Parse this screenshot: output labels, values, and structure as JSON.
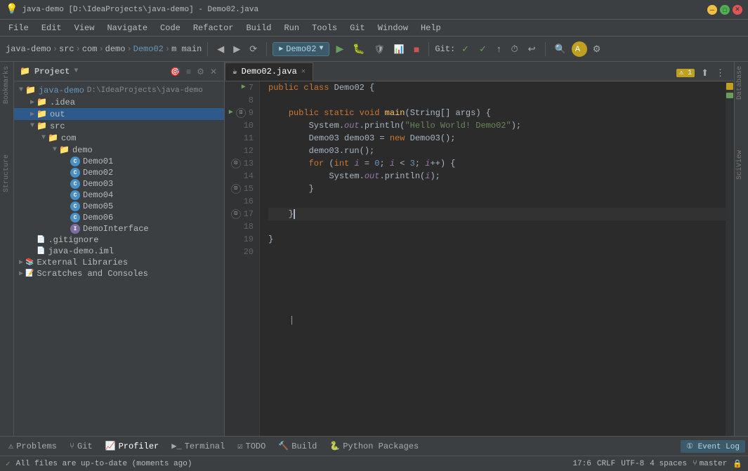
{
  "app": {
    "title": "java-demo [D:\\IdeaProjects\\java-demo] - Demo02.java",
    "icon": "💡"
  },
  "menu": {
    "items": [
      "File",
      "Edit",
      "View",
      "Navigate",
      "Code",
      "Refactor",
      "Build",
      "Run",
      "Tools",
      "Git",
      "Window",
      "Help"
    ]
  },
  "toolbar": {
    "breadcrumb": [
      "java-demo",
      "src",
      "com",
      "demo",
      "Demo02",
      "main"
    ],
    "config_name": "Demo02",
    "git_label": "Git:"
  },
  "project_panel": {
    "title": "Project",
    "root": {
      "name": "java-demo",
      "path": "D:\\IdeaProjects\\java-demo",
      "children": [
        {
          "name": ".idea",
          "type": "folder",
          "expanded": false
        },
        {
          "name": "out",
          "type": "folder",
          "expanded": false,
          "selected": true
        },
        {
          "name": "src",
          "type": "folder",
          "expanded": true,
          "children": [
            {
              "name": "com",
              "type": "folder",
              "expanded": true,
              "children": [
                {
                  "name": "demo",
                  "type": "folder",
                  "expanded": true,
                  "children": [
                    {
                      "name": "Demo01",
                      "type": "java"
                    },
                    {
                      "name": "Demo02",
                      "type": "java"
                    },
                    {
                      "name": "Demo03",
                      "type": "java"
                    },
                    {
                      "name": "Demo04",
                      "type": "java"
                    },
                    {
                      "name": "Demo05",
                      "type": "java"
                    },
                    {
                      "name": "Demo06",
                      "type": "java"
                    },
                    {
                      "name": "DemoInterface",
                      "type": "java-interface"
                    }
                  ]
                }
              ]
            }
          ]
        },
        {
          "name": ".gitignore",
          "type": "file"
        },
        {
          "name": "java-demo.iml",
          "type": "iml"
        }
      ]
    },
    "external_libraries": "External Libraries",
    "scratches": "Scratches and Consoles"
  },
  "editor": {
    "tab_name": "Demo02.java",
    "tab_icon": "☕",
    "warning_count": "1",
    "code_lines": [
      {
        "num": 7,
        "content": "public class Demo02 {",
        "tokens": [
          {
            "t": "kw",
            "v": "public "
          },
          {
            "t": "kw",
            "v": "class "
          },
          {
            "t": "cls",
            "v": "Demo02 "
          },
          {
            "t": "plain",
            "v": "{"
          }
        ]
      },
      {
        "num": 8,
        "content": "",
        "tokens": []
      },
      {
        "num": 9,
        "content": "    public static void main(String[] args) {",
        "tokens": [
          {
            "t": "kw",
            "v": "    public "
          },
          {
            "t": "kw",
            "v": "static "
          },
          {
            "t": "kw",
            "v": "void "
          },
          {
            "t": "fn",
            "v": "main"
          },
          {
            "t": "plain",
            "v": "("
          },
          {
            "t": "cls",
            "v": "String"
          },
          {
            "t": "plain",
            "v": "[] args) {"
          }
        ]
      },
      {
        "num": 10,
        "content": "        System.out.println(\"Hello World! Demo02\");",
        "tokens": [
          {
            "t": "plain",
            "v": "        System."
          },
          {
            "t": "italic",
            "v": "out"
          },
          {
            "t": "plain",
            "v": ".println("
          },
          {
            "t": "str",
            "v": "\"Hello World! Demo02\""
          },
          {
            "t": "plain",
            "v": ");"
          }
        ]
      },
      {
        "num": 11,
        "content": "        Demo03 demo03 = new Demo03();",
        "tokens": [
          {
            "t": "plain",
            "v": "        Demo03 demo03 = "
          },
          {
            "t": "kw",
            "v": "new "
          },
          {
            "t": "plain",
            "v": "Demo03();"
          }
        ]
      },
      {
        "num": 12,
        "content": "        demo03.run();",
        "tokens": [
          {
            "t": "plain",
            "v": "        demo03.run();"
          }
        ]
      },
      {
        "num": 13,
        "content": "        for (int i = 0; i < 3; i++) {",
        "tokens": [
          {
            "t": "kw",
            "v": "        for "
          },
          {
            "t": "plain",
            "v": "("
          },
          {
            "t": "kw",
            "v": "int "
          },
          {
            "t": "plain",
            "v": "i = "
          },
          {
            "t": "num",
            "v": "0"
          },
          {
            "t": "plain",
            "v": "; i < "
          },
          {
            "t": "num",
            "v": "3"
          },
          {
            "t": "plain",
            "v": "; i++) {"
          }
        ]
      },
      {
        "num": 14,
        "content": "            System.out.println(i);",
        "tokens": [
          {
            "t": "plain",
            "v": "            System."
          },
          {
            "t": "italic",
            "v": "out"
          },
          {
            "t": "plain",
            "v": ".println(i);"
          }
        ]
      },
      {
        "num": 15,
        "content": "        }",
        "tokens": [
          {
            "t": "plain",
            "v": "        }"
          }
        ]
      },
      {
        "num": 16,
        "content": "",
        "tokens": []
      },
      {
        "num": 17,
        "content": "    }",
        "tokens": [
          {
            "t": "plain",
            "v": "    }"
          }
        ],
        "cursor": true
      },
      {
        "num": 18,
        "content": "",
        "tokens": []
      },
      {
        "num": 19,
        "content": "}",
        "tokens": [
          {
            "t": "plain",
            "v": "}"
          }
        ]
      },
      {
        "num": 20,
        "content": "",
        "tokens": []
      }
    ]
  },
  "bottom_bar": {
    "tabs": [
      "Problems",
      "Git",
      "Profiler",
      "Terminal",
      "TODO",
      "Build",
      "Python Packages"
    ],
    "event_log": "1  Event Log"
  },
  "status_bar": {
    "message": "All files are up-to-date (moments ago)",
    "position": "17:6",
    "line_ending": "CRLF",
    "encoding": "UTF-8",
    "indent": "4 spaces",
    "vcs": "master",
    "lock_icon": "🔒"
  },
  "right_panels": [
    "Database",
    "SciView"
  ],
  "colors": {
    "accent_blue": "#6897bb",
    "accent_orange": "#cc7832",
    "accent_green": "#6a9e5c",
    "accent_yellow": "#ffc66d",
    "string_green": "#6a8759",
    "bg_dark": "#2b2b2b",
    "bg_panel": "#3c3f41",
    "warning": "#c0a020"
  }
}
